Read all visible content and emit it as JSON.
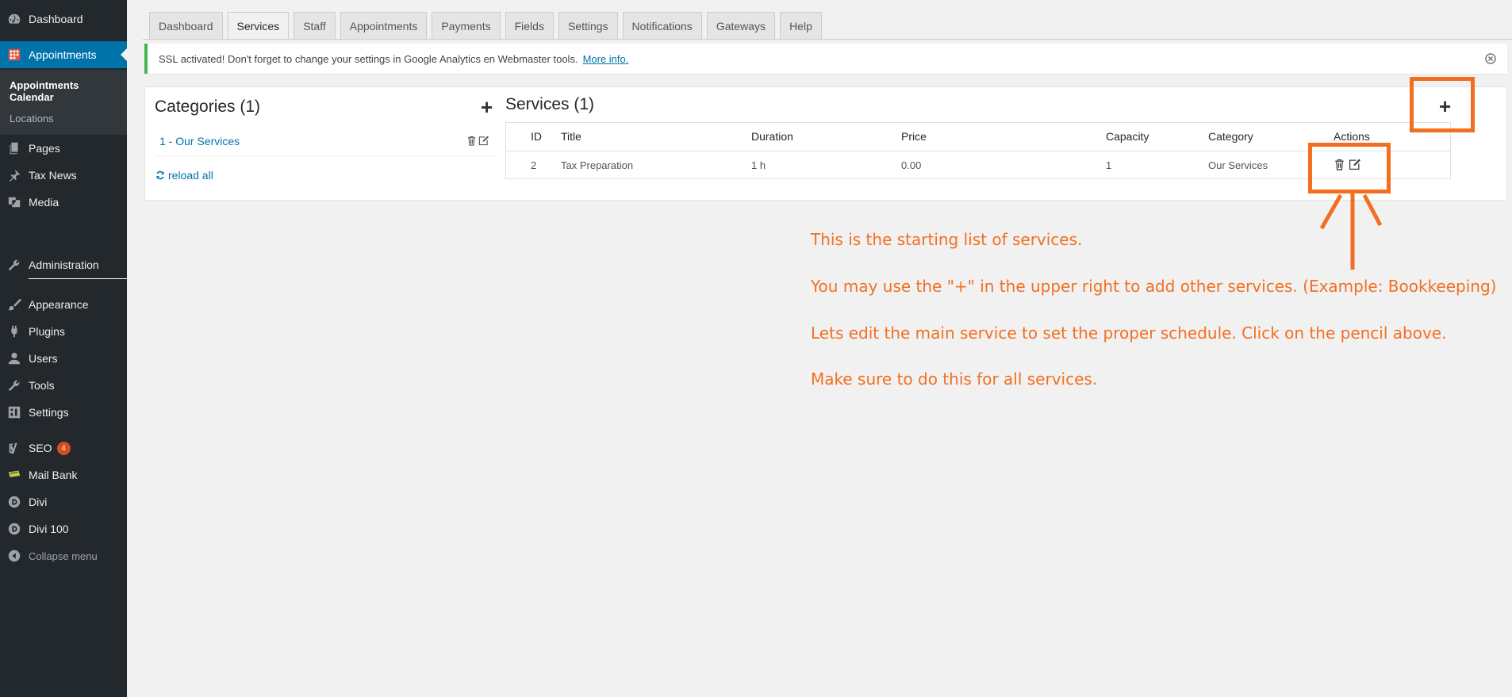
{
  "sidebar": {
    "items": [
      {
        "label": "Dashboard",
        "icon": "dashboard-icon"
      },
      {
        "label": "Appointments",
        "icon": "calendar-grid-icon"
      },
      {
        "label": "Pages",
        "icon": "pages-icon"
      },
      {
        "label": "Tax News",
        "icon": "pin-icon"
      },
      {
        "label": "Media",
        "icon": "media-icon"
      },
      {
        "label": "Administration",
        "icon": "wrench-icon"
      },
      {
        "label": "Appearance",
        "icon": "brush-icon"
      },
      {
        "label": "Plugins",
        "icon": "plug-icon"
      },
      {
        "label": "Users",
        "icon": "user-icon"
      },
      {
        "label": "Tools",
        "icon": "wrench-icon"
      },
      {
        "label": "Settings",
        "icon": "settings-icon"
      },
      {
        "label": "SEO",
        "icon": "yoast-icon",
        "badge": "4"
      },
      {
        "label": "Mail Bank",
        "icon": "mail-bank-icon"
      },
      {
        "label": "Divi",
        "icon": "divi-icon"
      },
      {
        "label": "Divi 100",
        "icon": "divi-icon"
      },
      {
        "label": "Collapse menu",
        "icon": "collapse-icon"
      }
    ],
    "submenu": [
      "Appointments Calendar",
      "Locations"
    ]
  },
  "tabs": [
    "Dashboard",
    "Services",
    "Staff",
    "Appointments",
    "Payments",
    "Fields",
    "Settings",
    "Notifications",
    "Gateways",
    "Help"
  ],
  "notice": {
    "text": "SSL activated!  Don't forget to change your settings in Google Analytics en Webmaster tools.",
    "link": "More info."
  },
  "categories": {
    "title": "Categories (1)",
    "items": [
      "1 - Our Services"
    ],
    "reload": "reload all"
  },
  "services": {
    "title": "Services (1)",
    "columns": [
      "ID",
      "Title",
      "Duration",
      "Price",
      "Capacity",
      "Category",
      "Actions"
    ],
    "rows": [
      {
        "id": "2",
        "title": "Tax Preparation",
        "duration": "1 h",
        "price": "0.00",
        "capacity": "1",
        "category": "Our Services"
      }
    ]
  },
  "annotations": [
    "This is the starting list of services.",
    "You may use the \"+\" in the upper right to add other services. (Example: Bookkeeping)",
    "Lets edit the main service to set the proper schedule. Click on the pencil above.",
    "Make sure to do this for all services."
  ],
  "colors": {
    "sidebar_bg": "#23282d",
    "active_blue": "#0073aa",
    "annotation_orange": "#f26f21",
    "notice_green": "#46b450"
  }
}
